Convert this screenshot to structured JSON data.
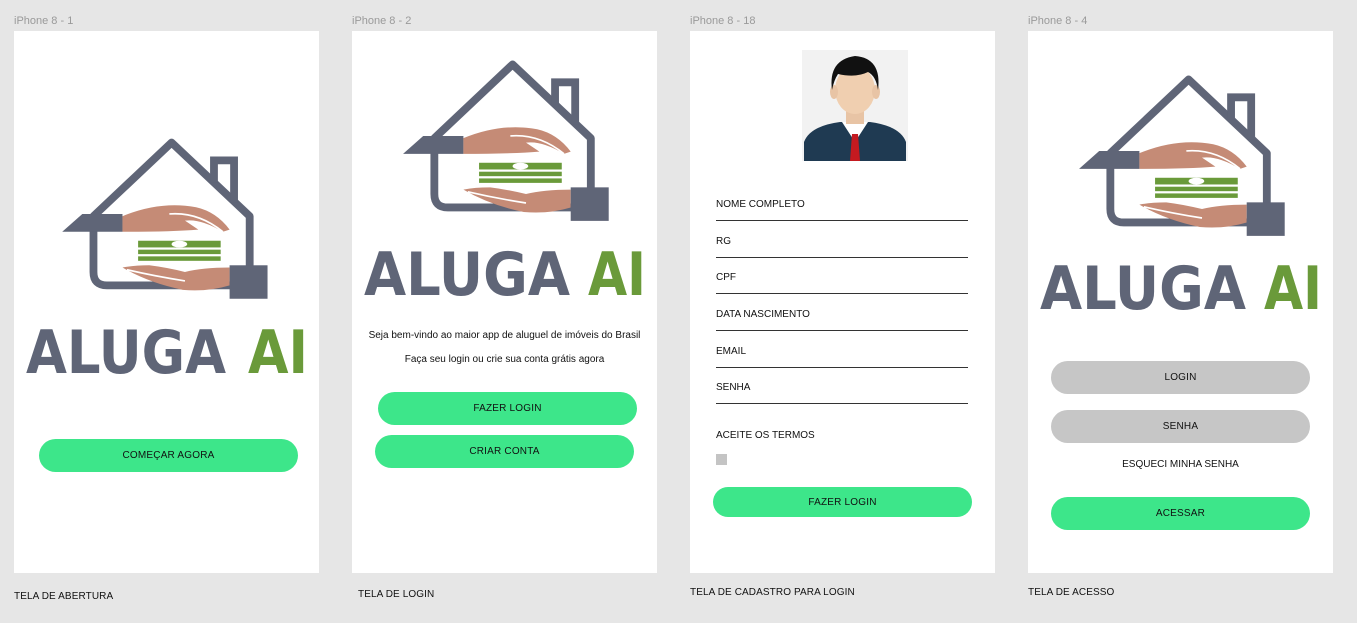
{
  "frames": [
    {
      "title": "iPhone 8 - 1",
      "caption": "TELA DE ABERTURA",
      "button": "COMEÇAR AGORA"
    },
    {
      "title": "iPhone 8 - 2",
      "caption": "TELA DE LOGIN",
      "welcome": "Seja bem-vindo ao maior app de aluguel de imóveis do Brasil",
      "subtitle": "Faça seu login ou crie sua conta grátis agora",
      "login_button": "FAZER LOGIN",
      "signup_button": "CRIAR CONTA"
    },
    {
      "title": "iPhone 8 - 18",
      "caption": "TELA DE CADASTRO PARA LOGIN",
      "fields": [
        "NOME COMPLETO",
        "RG",
        "CPF",
        "DATA NASCIMENTO",
        "EMAIL",
        "SENHA"
      ],
      "terms_label": "ACEITE OS TERMOS",
      "login_button": "FAZER LOGIN"
    },
    {
      "title": "iPhone 8 - 4",
      "caption": "TELA DE ACESSO",
      "login_field": "LOGIN",
      "password_field": "SENHA",
      "forgot_link": "ESQUECI MINHA SENHA",
      "access_button": "ACESSAR"
    }
  ],
  "logo": {
    "word1": "ALUGA",
    "word2": "AI"
  },
  "colors": {
    "accent": "#3de68a",
    "logo_gray": "#5f6577",
    "logo_green": "#6a9a3a",
    "hand": "#c58b76",
    "input_gray": "#c6c6c6"
  }
}
